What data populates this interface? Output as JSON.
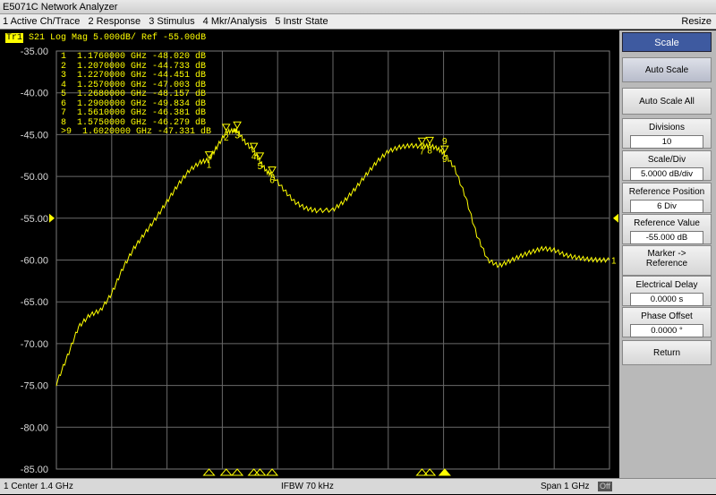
{
  "window": {
    "title": "E5071C Network Analyzer",
    "resize_label": "Resize"
  },
  "menu": {
    "items": [
      "1 Active Ch/Trace",
      "2 Response",
      "3 Stimulus",
      "4 Mkr/Analysis",
      "5 Instr State"
    ]
  },
  "trace": {
    "id": "Tr1",
    "header": "S21 Log Mag 5.000dB/ Ref -55.00dB",
    "color": "#ffff00",
    "end_marker": "1"
  },
  "chart_data": {
    "type": "line",
    "title": "S21 Log Mag 5.000dB/ Ref -55.00dB",
    "ylabel": "",
    "xlabel": "",
    "ylim": [
      -85,
      -35
    ],
    "xlim": [
      0.9,
      1.9
    ],
    "yticks": [
      "-35.00",
      "-40.00",
      "-45.00",
      "-50.00",
      "-55.00",
      "-60.00",
      "-65.00",
      "-70.00",
      "-75.00",
      "-80.00",
      "-85.00"
    ],
    "grid": true,
    "series": [
      {
        "x": [
          0.9,
          0.92,
          0.94,
          0.96,
          0.98,
          1.0,
          1.02,
          1.04,
          1.06,
          1.08,
          1.1,
          1.12,
          1.14,
          1.16,
          1.176,
          1.19,
          1.207,
          1.22,
          1.227,
          1.24,
          1.257,
          1.268,
          1.28,
          1.29,
          1.31,
          1.33,
          1.35,
          1.37,
          1.4,
          1.42,
          1.44,
          1.46,
          1.48,
          1.5,
          1.52,
          1.54,
          1.561,
          1.575,
          1.59,
          1.602,
          1.62,
          1.64,
          1.66,
          1.68,
          1.7,
          1.72,
          1.74,
          1.76,
          1.78,
          1.8,
          1.82,
          1.84,
          1.86,
          1.88,
          1.9
        ],
        "values": [
          -74.8,
          -71.5,
          -68.0,
          -66.6,
          -66.0,
          -64.0,
          -61.0,
          -58.6,
          -56.8,
          -55.0,
          -53.0,
          -51.0,
          -49.3,
          -48.3,
          -48.0,
          -46.5,
          -44.7,
          -44.5,
          -44.5,
          -45.8,
          -47.0,
          -48.2,
          -49.4,
          -49.8,
          -51.5,
          -53.0,
          -53.8,
          -54.1,
          -54.0,
          -53.0,
          -51.5,
          -49.8,
          -48.2,
          -47.0,
          -46.5,
          -46.3,
          -46.4,
          -46.3,
          -46.7,
          -47.3,
          -49.0,
          -52.5,
          -57.0,
          -60.0,
          -60.7,
          -60.1,
          -59.5,
          -59.0,
          -58.6,
          -58.8,
          -59.4,
          -59.7,
          -59.9,
          -60.0,
          -60.0
        ]
      }
    ],
    "markers": [
      {
        "label": "1",
        "x": 1.176,
        "y": -48.02
      },
      {
        "label": "2",
        "x": 1.207,
        "y": -44.733
      },
      {
        "label": "3",
        "x": 1.227,
        "y": -44.451
      },
      {
        "label": "4",
        "x": 1.257,
        "y": -47.003
      },
      {
        "label": "5",
        "x": 1.268,
        "y": -48.157
      },
      {
        "label": "6",
        "x": 1.29,
        "y": -49.834
      },
      {
        "label": "7",
        "x": 1.561,
        "y": -46.381
      },
      {
        "label": "8",
        "x": 1.575,
        "y": -46.279
      },
      {
        "label": "9",
        "x": 1.602,
        "y": -47.331,
        "active": true
      }
    ],
    "reference_level": -55.0
  },
  "marker_table": [
    "1  1.1760000 GHz -48.020 dB",
    "2  1.2070000 GHz -44.733 dB",
    "3  1.2270000 GHz -44.451 dB",
    "4  1.2570000 GHz -47.003 dB",
    "5  1.2680000 GHz -48.157 dB",
    "6  1.2900000 GHz -49.834 dB",
    "7  1.5610000 GHz -46.381 dB",
    "8  1.5750000 GHz -46.279 dB",
    ">9  1.6020000 GHz -47.331 dB"
  ],
  "status": {
    "center": "1  Center 1.4 GHz",
    "ifbw": "IFBW 70 kHz",
    "span": "Span 1 GHz",
    "off_badge": "Off"
  },
  "softkeys": {
    "scale_title": "Scale",
    "auto_scale": "Auto Scale",
    "auto_scale_all": "Auto Scale All",
    "divisions_label": "Divisions",
    "divisions_value": "10",
    "scale_div_label": "Scale/Div",
    "scale_div_value": "5.0000 dB/div",
    "ref_pos_label": "Reference Position",
    "ref_pos_value": "6 Div",
    "ref_val_label": "Reference Value",
    "ref_val_value": "-55.000 dB",
    "marker_ref_l1": "Marker ->",
    "marker_ref_l2": "Reference",
    "elec_delay_label": "Electrical Delay",
    "elec_delay_value": "0.0000 s",
    "phase_offset_label": "Phase Offset",
    "phase_offset_value": "0.0000 °",
    "return": "Return"
  }
}
